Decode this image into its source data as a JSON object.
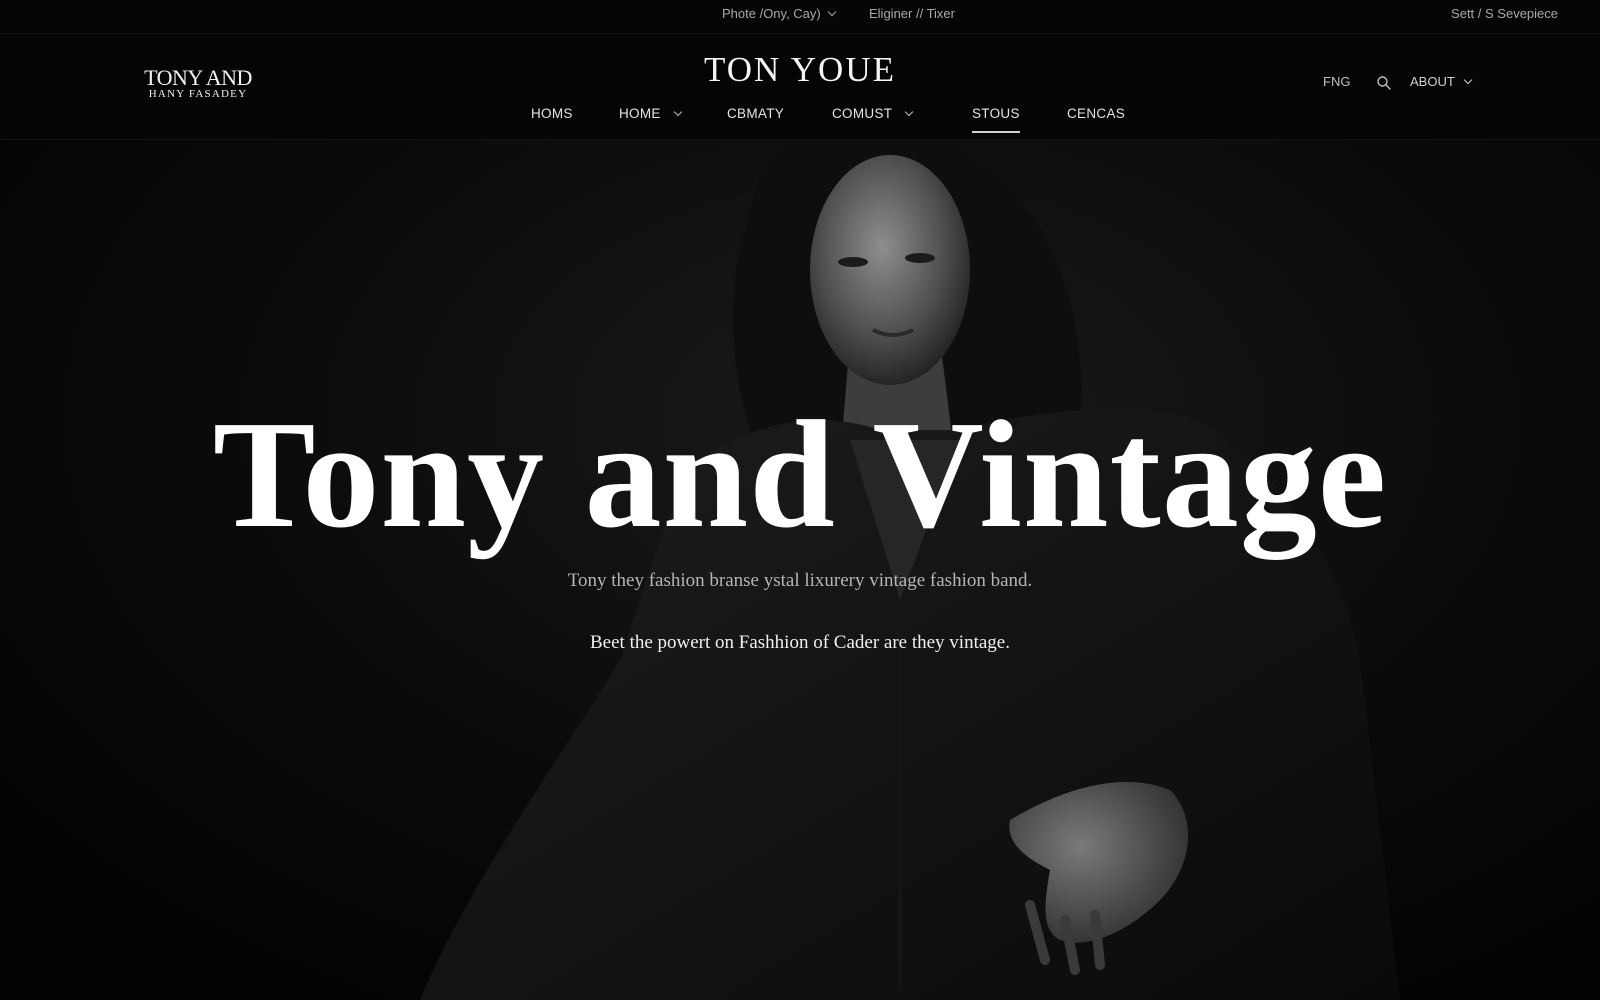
{
  "utility_bar": {
    "locale_label": "Phote /Ony, Cay)",
    "designer_label": "Eliginer // Tixer",
    "account_label": "Sett  /  S Sevepiece"
  },
  "header": {
    "logo": {
      "line1": "TONY AND",
      "line2": "HANY FASADEY"
    },
    "brand_title": "TON YOUE",
    "nav": [
      {
        "label": "HOMS",
        "has_dropdown": false,
        "active": false
      },
      {
        "label": "HOME",
        "has_dropdown": true,
        "active": false
      },
      {
        "label": "CBMATY",
        "has_dropdown": false,
        "active": false
      },
      {
        "label": "COMUST",
        "has_dropdown": true,
        "active": false
      },
      {
        "label": "STOUS",
        "has_dropdown": false,
        "active": true
      },
      {
        "label": "CENCAS",
        "has_dropdown": false,
        "active": false
      }
    ],
    "right": {
      "lang_label": "FNG",
      "search_icon": "search-icon",
      "about_label": "ABOUT"
    }
  },
  "hero": {
    "title": "Tony and Vintage",
    "tagline": "Tony they fashion branse ystal lixurery vintage fashion band.",
    "subline": "Beet the powert on Fashhion of Cader are they vintage.",
    "background": "black-and-white portrait photo"
  },
  "colors": {
    "background": "#030303",
    "text_primary": "#ffffff",
    "text_muted": "#b5b5b5",
    "active_underline": "#cfcfcf"
  }
}
